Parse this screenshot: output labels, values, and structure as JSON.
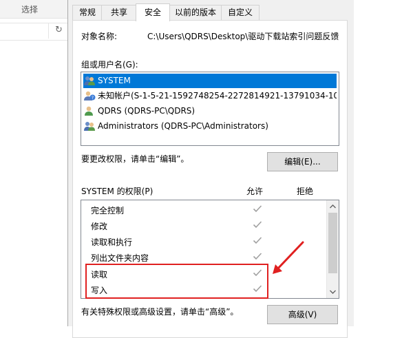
{
  "background": {
    "ribbon_label": "选择",
    "refresh_icon": "refresh-icon"
  },
  "dialog": {
    "tabs": [
      {
        "label": "常规",
        "active": false
      },
      {
        "label": "共享",
        "active": false
      },
      {
        "label": "安全",
        "active": true
      },
      {
        "label": "以前的版本",
        "active": false
      },
      {
        "label": "自定义",
        "active": false
      }
    ],
    "object_name_label": "对象名称:",
    "object_name_value": "C:\\Users\\QDRS\\Desktop\\驱动下载站索引问题反馈",
    "group_users_label": "组或用户名(G):",
    "users": [
      {
        "name": "SYSTEM",
        "selected": true,
        "icon": "users-icon"
      },
      {
        "name": "未知帐户(S-1-5-21-1592748254-2272814921-13791034-10...",
        "selected": false,
        "icon": "unknown-user-icon"
      },
      {
        "name": "QDRS (QDRS-PC\\QDRS)",
        "selected": false,
        "icon": "user-icon"
      },
      {
        "name": "Administrators (QDRS-PC\\Administrators)",
        "selected": false,
        "icon": "users-icon"
      }
    ],
    "change_hint": "要更改权限，请单击“编辑”。",
    "edit_button": "编辑(E)...",
    "permissions_label": "SYSTEM 的权限(P)",
    "allow_header": "允许",
    "deny_header": "拒绝",
    "permissions": [
      {
        "name": "完全控制",
        "allow": true,
        "deny": false
      },
      {
        "name": "修改",
        "allow": true,
        "deny": false
      },
      {
        "name": "读取和执行",
        "allow": true,
        "deny": false
      },
      {
        "name": "列出文件夹内容",
        "allow": true,
        "deny": false
      },
      {
        "name": "读取",
        "allow": true,
        "deny": false
      },
      {
        "name": "写入",
        "allow": true,
        "deny": false
      }
    ],
    "advanced_hint": "有关特殊权限或高级设置，请单击“高级”。",
    "advanced_button": "高级(V)"
  },
  "annotation": {
    "highlight_color": "#e02020"
  }
}
